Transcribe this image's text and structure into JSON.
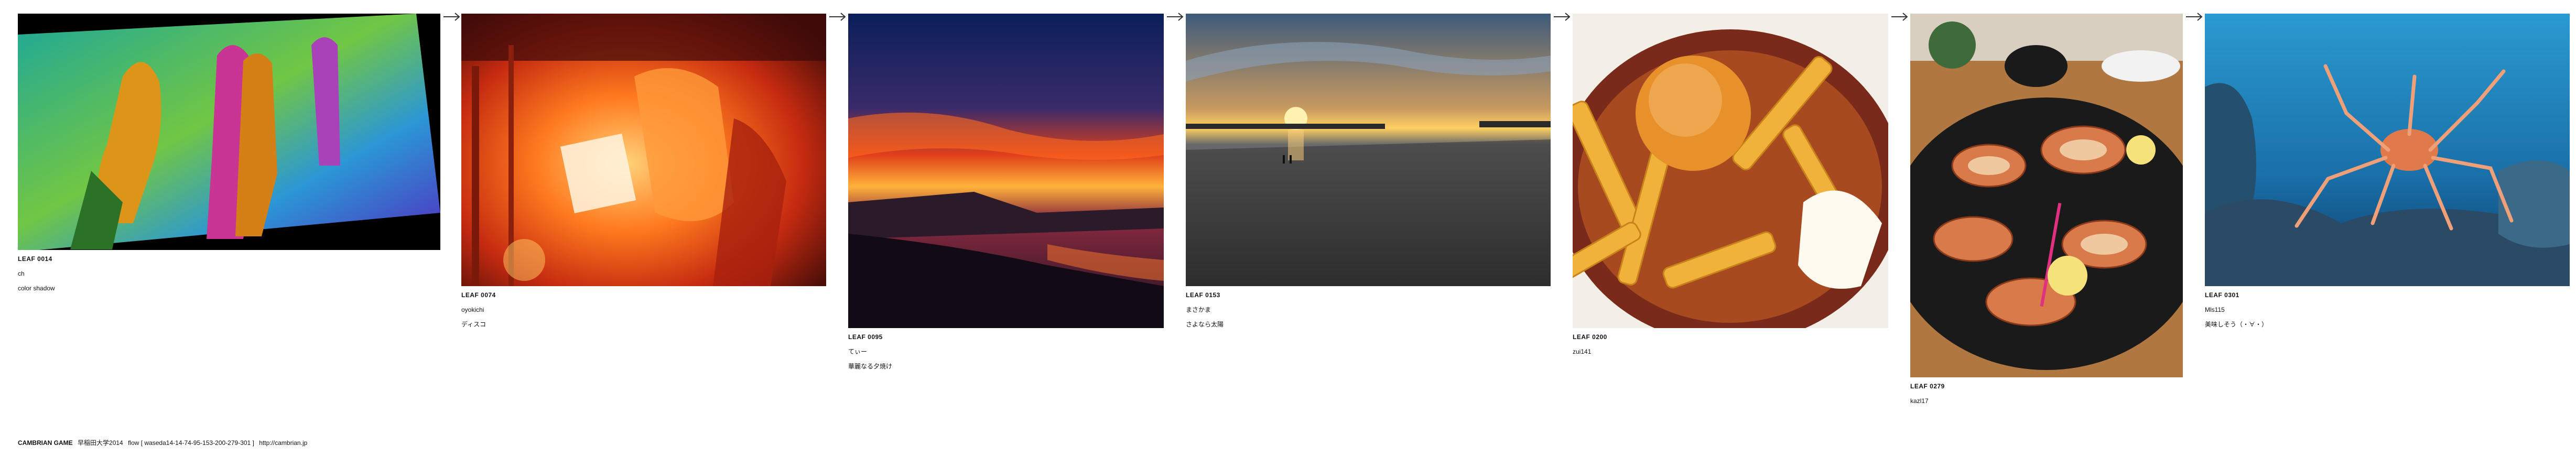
{
  "leaves": [
    {
      "code": "LEAF 0014",
      "user": "ch",
      "title": "color shadow"
    },
    {
      "code": "LEAF 0074",
      "user": "oyokichi",
      "title": "ディスコ"
    },
    {
      "code": "LEAF 0095",
      "user": "てぃー",
      "title": "華麗なる夕焼け"
    },
    {
      "code": "LEAF 0153",
      "user": "まさかま",
      "title": "さよなら太陽"
    },
    {
      "code": "LEAF 0200",
      "user": "zui141",
      "title": ""
    },
    {
      "code": "LEAF 0279",
      "user": "kazl17",
      "title": ""
    },
    {
      "code": "LEAF 0301",
      "user": "Mls115",
      "title": "美味しそう（・∀・）"
    }
  ],
  "footer": {
    "brand": "CAMBRIAN GAME",
    "subtitle": "早稲田大学2014",
    "flow": "flow [ waseda14-14-74-95-153-200-279-301 ]",
    "url": "http://cambrian.jp"
  }
}
